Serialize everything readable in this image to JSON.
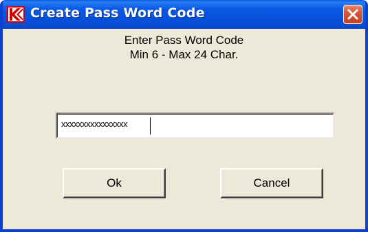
{
  "window": {
    "title": "Create Pass Word Code",
    "icon": "k-logo-icon",
    "close_icon": "close-icon",
    "accent_color": "#0a5ee8",
    "close_color": "#d7553a"
  },
  "prompt": {
    "line1": "Enter Pass Word Code",
    "line2": "Min 6  - Max 24 Char."
  },
  "password_field": {
    "value": "xxxxxxxxxxxxxxxx"
  },
  "buttons": {
    "ok_label": "Ok",
    "cancel_label": "Cancel"
  }
}
